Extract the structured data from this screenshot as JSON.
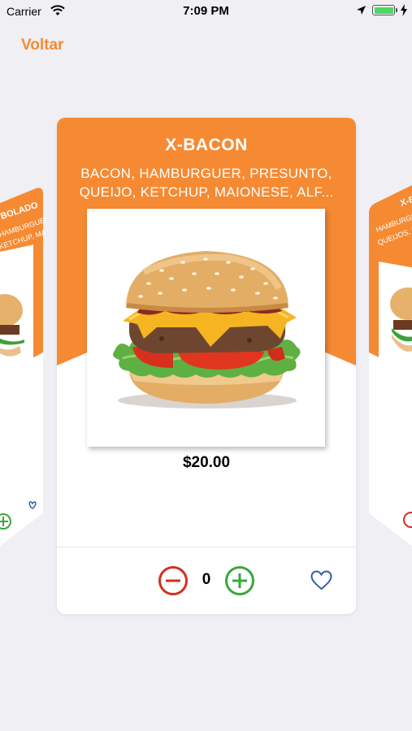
{
  "status_bar": {
    "carrier": "Carrier",
    "time": "7:09 PM"
  },
  "nav": {
    "back_label": "Voltar"
  },
  "colors": {
    "accent": "#f58a33",
    "minus": "#d0311f",
    "plus": "#37a83a",
    "heart": "#2f5fa8",
    "battery": "#4cd964"
  },
  "product": {
    "name": "X-BACON",
    "description_line1": "BACON, HAMBURGUER, PRESUNTO,",
    "description_line2": "QUEIJO, KETCHUP, MAIONESE, ALF...",
    "price": "$20.00",
    "quantity": "0",
    "image_icon": "burger-image"
  },
  "left_card": {
    "title_fragment": "BOLADO",
    "desc_line1": "HAMBURGUER,",
    "desc_line2": "KETCHUP, MAI..."
  },
  "right_card": {
    "title_fragment": "X-B",
    "desc_line1": "HAMBURGUER,",
    "desc_line2": "QUEIJOS, KETCH"
  },
  "icons": {
    "minus": "minus-circle-icon",
    "plus": "plus-circle-icon",
    "favorite": "heart-outline-icon"
  }
}
